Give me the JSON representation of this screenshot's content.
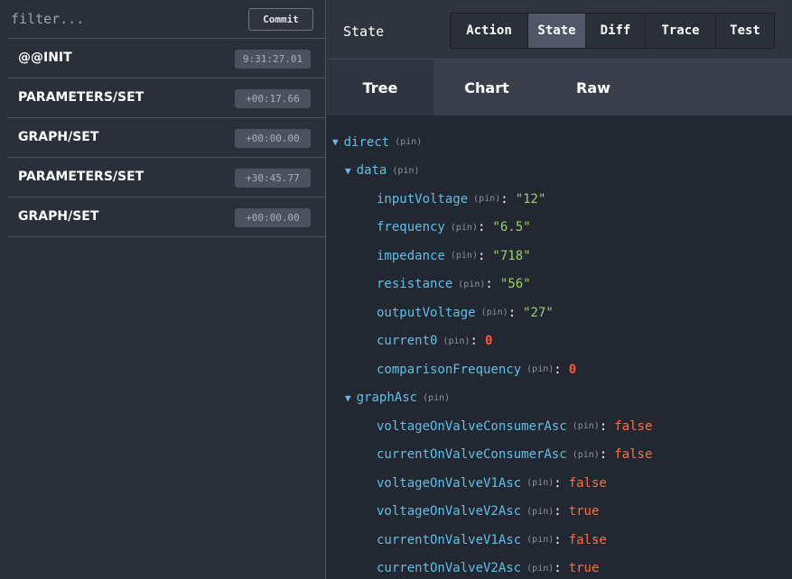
{
  "filter": {
    "placeholder": "filter...",
    "commit_label": "Commit"
  },
  "actions": [
    {
      "name": "@@INIT",
      "time": "9:31:27.01"
    },
    {
      "name": "PARAMETERS/SET",
      "time": "+00:17.66"
    },
    {
      "name": "GRAPH/SET",
      "time": "+00:00.00"
    },
    {
      "name": "PARAMETERS/SET",
      "time": "+30:45.77"
    },
    {
      "name": "GRAPH/SET",
      "time": "+00:00.00"
    }
  ],
  "monitor": {
    "title": "State",
    "tabs": [
      "Action",
      "State",
      "Diff",
      "Trace",
      "Test"
    ],
    "active_tab": "State",
    "subtabs": [
      "Tree",
      "Chart",
      "Raw"
    ],
    "active_subtab": "Tree"
  },
  "tree": {
    "pin_label": "(pin)",
    "arrow": "▼",
    "direct_key": "direct",
    "data_key": "data",
    "data_items": [
      {
        "key": "inputVoltage",
        "value": "\"12\"",
        "kind": "str"
      },
      {
        "key": "frequency",
        "value": "\"6.5\"",
        "kind": "str"
      },
      {
        "key": "impedance",
        "value": "\"718\"",
        "kind": "str"
      },
      {
        "key": "resistance",
        "value": "\"56\"",
        "kind": "str"
      },
      {
        "key": "outputVoltage",
        "value": "\"27\"",
        "kind": "str"
      },
      {
        "key": "current0",
        "value": "0",
        "kind": "num"
      },
      {
        "key": "comparisonFrequency",
        "value": "0",
        "kind": "num"
      }
    ],
    "graph_key": "graphAsc",
    "graph_items": [
      {
        "key": "voltageOnValveConsumerAsc",
        "value": "false",
        "kind": "bool"
      },
      {
        "key": "currentOnValveConsumerAsc",
        "value": "false",
        "kind": "bool"
      },
      {
        "key": "voltageOnValveV1Asc",
        "value": "false",
        "kind": "bool"
      },
      {
        "key": "voltageOnValveV2Asc",
        "value": "true",
        "kind": "bool"
      },
      {
        "key": "currentOnValveV1Asc",
        "value": "false",
        "kind": "bool"
      },
      {
        "key": "currentOnValveV2Asc",
        "value": "true",
        "kind": "bool"
      }
    ]
  },
  "colors": {
    "background": "#2a2f3a",
    "key": "#5fc0e6",
    "string": "#9ad16a",
    "number": "#ff5a36",
    "boolean": "#ff6e3c"
  }
}
